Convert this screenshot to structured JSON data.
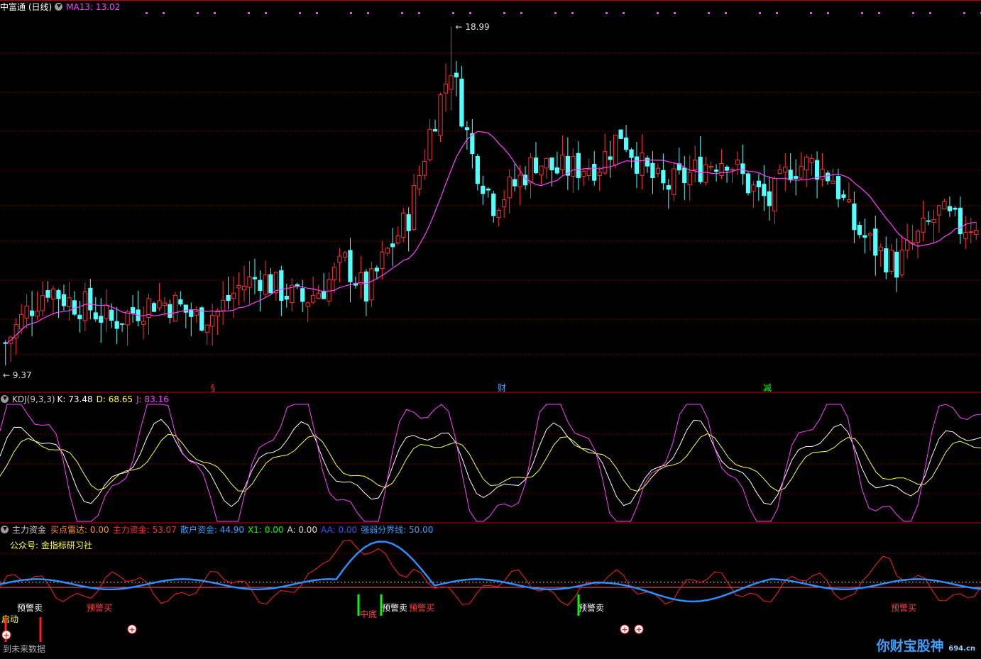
{
  "main_panel": {
    "title": "中富通 (日线)",
    "ma_label": "MA13: 13.02",
    "price_high_label": "18.99",
    "price_low_label": "9.37",
    "event_markers": [
      {
        "text": "§",
        "color": "#ff3030"
      },
      {
        "text": "财",
        "color": "#4aa3ff"
      },
      {
        "text": "减",
        "color": "#00ff00"
      }
    ]
  },
  "kdj_panel": {
    "name": "KDJ(9,3,3)",
    "k_label": "K: 73.48",
    "d_label": "D: 68.65",
    "j_label": "J: 83.16"
  },
  "fund_panel": {
    "name": "主力资金",
    "items": [
      {
        "text": "买点雷达: 0.00",
        "color": "#ff9030"
      },
      {
        "text": "主力资金: 53.07",
        "color": "#ff3030"
      },
      {
        "text": "散户资金: 44.90",
        "color": "#3a9fff"
      },
      {
        "text": "X1: 0.00",
        "color": "#00ff00"
      },
      {
        "text": "A: 0.00",
        "color": "#dddddd"
      },
      {
        "text": "AA: 0.00",
        "color": "#2a5aff"
      },
      {
        "text": "强弱分界线: 50.00",
        "color": "#3aa0ff"
      }
    ],
    "subtitle": "公众号: 金指标研习社",
    "signal_labels": [
      "预警卖",
      "预警买",
      "中底",
      "启动",
      "到未来数据"
    ]
  },
  "watermark": {
    "text": "你财宝股神",
    "sub": "694.cn"
  },
  "colors": {
    "up": "#ff3030",
    "down": "#54ffff",
    "ma": "#ff40ff",
    "k": "#ffffff",
    "d": "#ffff40",
    "j": "#ff40ff",
    "grid": "#8a0000",
    "border": "#c00000"
  },
  "chart_data": [
    {
      "type": "candlestick",
      "title": "中富通 (日线)",
      "series_label": "MA13",
      "last_ma": 13.02,
      "annotated_high": 18.99,
      "annotated_low": 9.37,
      "close_trend": [
        10.0,
        10.9,
        11.6,
        11.2,
        11.0,
        10.6,
        10.9,
        11.2,
        11.1,
        10.7,
        10.9,
        11.6,
        11.9,
        11.5,
        11.2,
        11.6,
        12.3,
        11.4,
        12.6,
        13.6,
        16.0,
        17.9,
        15.3,
        14.0,
        14.5,
        15.2,
        14.9,
        15.0,
        15.1,
        16.0,
        15.0,
        14.4,
        14.7,
        15.1,
        15.3,
        14.5,
        14.0,
        15.0,
        15.1,
        14.7,
        13.3,
        12.7,
        12.2,
        13.0,
        13.7,
        13.3,
        13.5
      ]
    },
    {
      "type": "line",
      "title": "KDJ(9,3,3)",
      "series": [
        {
          "name": "K",
          "last": 73.48
        },
        {
          "name": "D",
          "last": 68.65
        },
        {
          "name": "J",
          "last": 83.16
        }
      ]
    },
    {
      "type": "line",
      "title": "主力资金",
      "series": [
        {
          "name": "主力资金",
          "last": 53.07
        },
        {
          "name": "散户资金",
          "last": 44.9
        },
        {
          "name": "强弱分界线",
          "last": 50.0
        }
      ]
    }
  ]
}
